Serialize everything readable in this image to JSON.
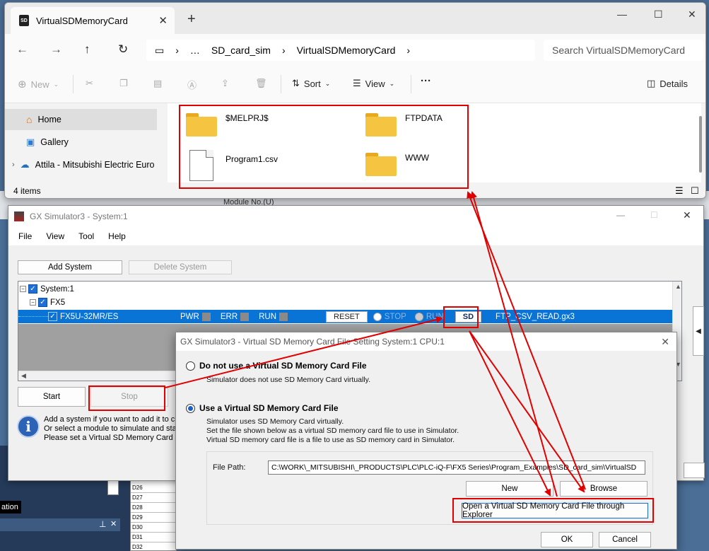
{
  "background": {
    "module_no_label": "Module No.(U)",
    "label_fragment_left": "ation",
    "table_rows": [
      "D26",
      "D27",
      "D28",
      "D29",
      "D30",
      "D31",
      "D32"
    ]
  },
  "explorer": {
    "tab_title": "VirtualSDMemoryCard",
    "tab_close": "✕",
    "new_tab": "+",
    "controls": {
      "minimize": "—",
      "maximize": "☐",
      "close": "✕"
    },
    "breadcrumb": [
      "…",
      "SD_card_sim",
      "VirtualSDMemoryCard"
    ],
    "search_placeholder": "Search VirtualSDMemoryCard",
    "toolbar": {
      "new": "New",
      "sort": "Sort",
      "view": "View",
      "more": "···",
      "details": "Details"
    },
    "nav": [
      {
        "label": "Home"
      },
      {
        "label": "Gallery"
      },
      {
        "label": "Attila - Mitsubishi Electric Euro"
      }
    ],
    "files": [
      {
        "name": "$MELPRJ$",
        "type": "folder"
      },
      {
        "name": "FTPDATA",
        "type": "folder"
      },
      {
        "name": "Program1.csv",
        "type": "file"
      },
      {
        "name": "WWW",
        "type": "folder"
      }
    ],
    "status": "4 items"
  },
  "gx": {
    "title": "GX Simulator3 - System:1",
    "menu": [
      "File",
      "View",
      "Tool",
      "Help"
    ],
    "add_system": "Add System",
    "delete_system": "Delete System",
    "tree": {
      "system": "System:1",
      "series": "FX5",
      "module": "FX5U-32MR/ES",
      "pwr": "PWR",
      "err": "ERR",
      "run": "RUN",
      "reset": "RESET",
      "stop_radio": "STOP",
      "run_radio": "RUN",
      "sd": "SD",
      "project": "FTP_CSV_READ.gx3"
    },
    "start": "Start",
    "stop": "Stop",
    "info": [
      "Add a system if you want to add it to cur",
      "Or select a module to simulate and start.",
      "Please set a Virtual SD Memory Card File"
    ]
  },
  "sd_dialog": {
    "title": "GX Simulator3  - Virtual SD Memory Card File Setting System:1 CPU:1",
    "option_off": "Do not use a Virtual SD Memory Card File",
    "option_off_desc": "Simulator does not use SD Memory Card virtually.",
    "option_on": "Use a Virtual SD Memory Card File",
    "option_on_desc": [
      "Simulator uses SD Memory Card virtually.",
      "Set the file shown below as a virtual SD memory card file to use in Simulator.",
      "Virtual SD memory card file is a file to use as SD memory card in Simulator."
    ],
    "file_path_label": "File Path:",
    "file_path_value": "C:\\WORK\\_MITSUBISHI\\_PRODUCTS\\PLC\\PLC-iQ-F\\FX5 Series\\Program_Examples\\SD_card_sim\\VirtualSD",
    "new_button": "New",
    "browse_button": "Browse",
    "open_explorer_button": "Open a Virtual SD Memory Card File through Explorer",
    "ok": "OK",
    "cancel": "Cancel"
  },
  "colors": {
    "highlight": "#e00000",
    "selection": "#0a73d6",
    "folder": "#f5c542"
  }
}
